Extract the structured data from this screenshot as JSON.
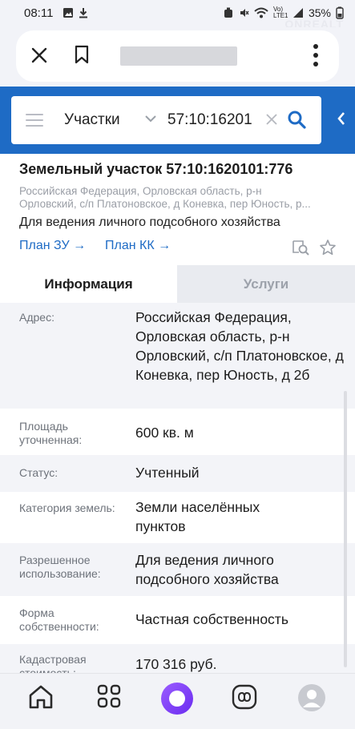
{
  "status_bar": {
    "time": "08:11",
    "network": "Vo) LTE1",
    "battery": "35%"
  },
  "watermark": "ONREALT",
  "search": {
    "type": "Участки",
    "value": "57:10:16201"
  },
  "parcel": {
    "title": "Земельный участок 57:10:1620101:776",
    "address_line1": "Российская Федерация, Орловская область, р-н",
    "address_line2": "Орловский, с/п Платоновское, д Коневка, пер Юность, р...",
    "use": "Для ведения личного подсобного хозяйства",
    "plan_zu": "План ЗУ →",
    "plan_kk": "План КК →"
  },
  "tabs": {
    "info": "Информация",
    "services": "Услуги"
  },
  "details": [
    {
      "label": "Адрес:",
      "value": "Российская Федерация, Орловская область, р-н Орловский, с/п Платоновское, д Коневка, пер Юность, д 2б"
    },
    {
      "label": "Площадь уточненная:",
      "value": "600 кв. м"
    },
    {
      "label": "Статус:",
      "value": "Учтенный"
    },
    {
      "label": "Категория земель:",
      "value": "Земли населённых пунктов"
    },
    {
      "label": "Разрешенное использование:",
      "value": "Для ведения личного подсобного хозяйства"
    },
    {
      "label": "Форма собственности:",
      "value": "Частная собственность"
    },
    {
      "label": "Кадастровая стоимость:",
      "value": "170 316 руб."
    }
  ]
}
